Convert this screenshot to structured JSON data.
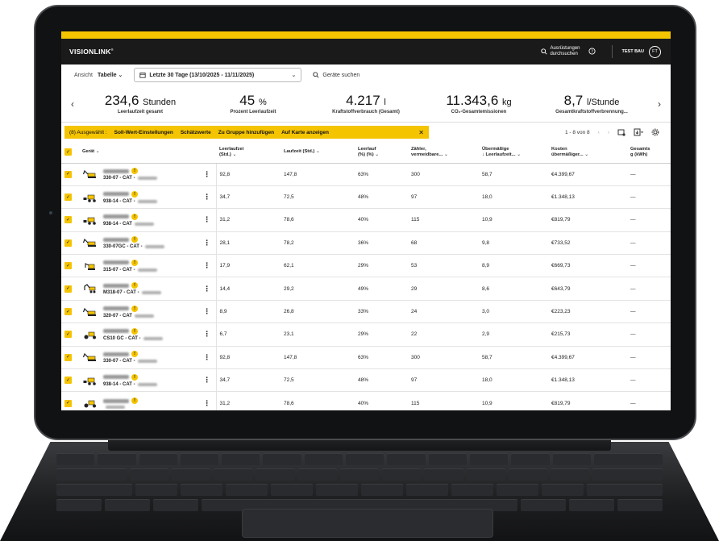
{
  "app": {
    "logo": "VISIONLINK",
    "logo_mark": "®",
    "nav_search": [
      "Ausrüstungen",
      "durchsuchen"
    ],
    "help_icon": "question-circle-icon",
    "user_company": "TEST BAU",
    "user_initials": "FT"
  },
  "filters": {
    "view_label": "Ansicht",
    "view_value": "Tabelle",
    "date_range": "Letzte 30 Tage (13/10/2025 - 11/11/2025)",
    "search_label": "Geräte suchen"
  },
  "kpis": [
    {
      "value": "234,6",
      "unit": "Stunden",
      "label": "Leerlaufzeit gesamt"
    },
    {
      "value": "45",
      "unit": "%",
      "label": "Prozent Leerlaufzeit"
    },
    {
      "value": "4.217",
      "unit": "l",
      "label": "Kraftstoffverbrauch (Gesamt)"
    },
    {
      "value": "11.343,6",
      "unit": "kg",
      "label": "CO₂-Gesamtemissionen"
    },
    {
      "value": "8,7",
      "unit": "l/Stunde",
      "label": "Gesamtkraftstoffverbrennung..."
    }
  ],
  "selection": {
    "count": "(8) Ausgewählt :",
    "actions": [
      "Soll-Wert-Einstellungen",
      "Schätzwerte",
      "Zu Gruppe hinzufügen",
      "Auf Karte anzeigen"
    ],
    "close": "✕"
  },
  "pager": {
    "text": "1 - 8 von 8",
    "prev": "‹",
    "next": "›"
  },
  "table": {
    "headers": {
      "device": "Gerät",
      "idle_time": [
        "Leerlaufzei",
        "(Std.)"
      ],
      "runtime": "Laufzeit (Std.)",
      "idle_pct": [
        "Leerlauf",
        "(%) (%)"
      ],
      "counter": [
        "Zähler,",
        "vermeidbare..."
      ],
      "excess_idle": [
        "Übermäßige",
        "↓ Leerlaufzeit..."
      ],
      "cost": [
        "Kosten",
        "übermäßiger..."
      ],
      "total": [
        "Gesamts",
        "g (kWh)"
      ]
    },
    "rows": [
      {
        "model": "330-07 - CAT -",
        "icon": "excavator-icon",
        "idle": "92,8",
        "run": "147,8",
        "pct": "63%",
        "counter": "300",
        "excess": "58,7",
        "cost": "€4.399,67",
        "total": "—"
      },
      {
        "model": "938-14 - CAT -",
        "icon": "wheel-loader-icon",
        "idle": "34,7",
        "run": "72,5",
        "pct": "48%",
        "counter": "97",
        "excess": "18,0",
        "cost": "€1.348,13",
        "total": "—"
      },
      {
        "model": "938-14 - CAT",
        "icon": "wheel-loader-icon",
        "idle": "31,2",
        "run": "78,6",
        "pct": "40%",
        "counter": "115",
        "excess": "10,9",
        "cost": "€819,79",
        "total": "—"
      },
      {
        "model": "330-07GC - CAT -",
        "icon": "excavator-icon",
        "idle": "28,1",
        "run": "78,2",
        "pct": "36%",
        "counter": "68",
        "excess": "9,8",
        "cost": "€733,52",
        "total": "—"
      },
      {
        "model": "315-07 - CAT -",
        "icon": "mini-excavator-icon",
        "idle": "17,9",
        "run": "62,1",
        "pct": "29%",
        "counter": "53",
        "excess": "8,9",
        "cost": "€669,73",
        "total": "—"
      },
      {
        "model": "M318-07 - CAT -",
        "icon": "wheeled-excavator-icon",
        "idle": "14,4",
        "run": "29,2",
        "pct": "49%",
        "counter": "29",
        "excess": "8,6",
        "cost": "€643,79",
        "total": "—"
      },
      {
        "model": "320-07 - CAT",
        "icon": "excavator-icon",
        "idle": "8,9",
        "run": "26,8",
        "pct": "33%",
        "counter": "24",
        "excess": "3,0",
        "cost": "€223,23",
        "total": "—"
      },
      {
        "model": "CS10 GC - CAT -",
        "icon": "compactor-icon",
        "idle": "6,7",
        "run": "23,1",
        "pct": "29%",
        "counter": "22",
        "excess": "2,9",
        "cost": "€215,73",
        "total": "—"
      },
      {
        "model": "330-07 - CAT -",
        "icon": "excavator-icon",
        "idle": "92,8",
        "run": "147,8",
        "pct": "63%",
        "counter": "300",
        "excess": "58,7",
        "cost": "€4.399,67",
        "total": "—"
      },
      {
        "model": "938-14 - CAT -",
        "icon": "wheel-loader-icon",
        "idle": "34,7",
        "run": "72,5",
        "pct": "48%",
        "counter": "97",
        "excess": "18,0",
        "cost": "€1.348,13",
        "total": "—"
      },
      {
        "model": "",
        "icon": "compactor-icon",
        "idle": "31,2",
        "run": "78,6",
        "pct": "40%",
        "counter": "115",
        "excess": "10,9",
        "cost": "€819,79",
        "total": "—"
      }
    ]
  },
  "colors": {
    "accent": "#f5c400",
    "nav_bg": "#1a1a1a",
    "device_frame": "#111213"
  }
}
